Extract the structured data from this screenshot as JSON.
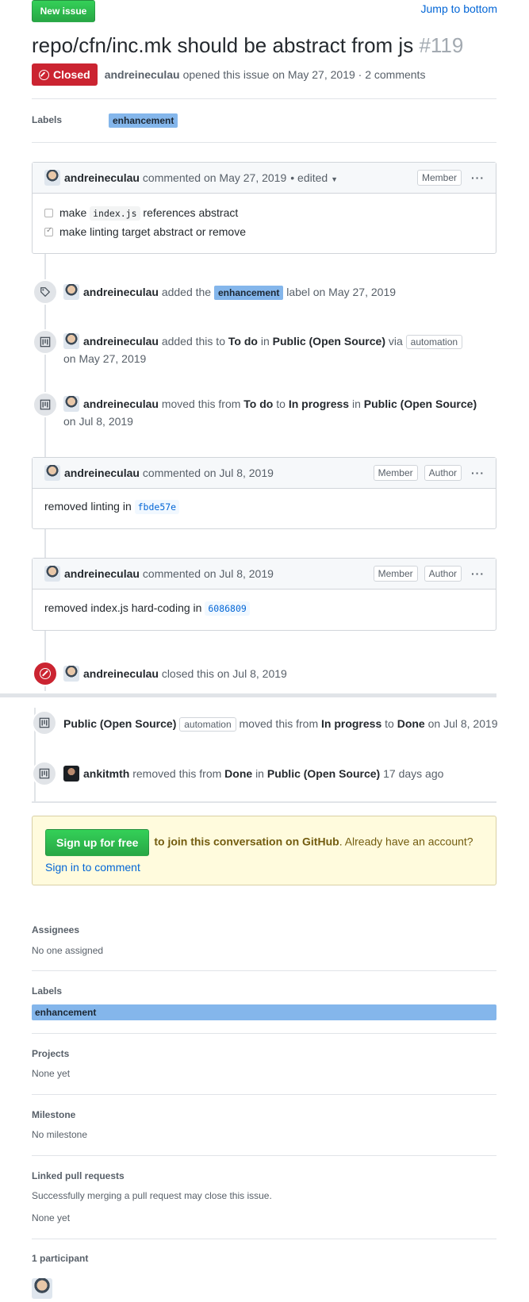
{
  "header": {
    "new_issue_label": "New issue",
    "jump_label": "Jump to bottom",
    "title": "repo/cfn/inc.mk should be abstract from js",
    "number": "#119",
    "state_label": "Closed",
    "author": "andreineculau",
    "meta": "opened this issue on May 27, 2019 · 2 comments"
  },
  "labels_row": {
    "heading": "Labels",
    "label": "enhancement"
  },
  "comment1": {
    "author": "andreineculau",
    "meta": "commented on May 27, 2019",
    "edited": "• edited",
    "role": "Member",
    "tasks": [
      {
        "pre": "make",
        "code": "index.js",
        "post": "references abstract",
        "checked": false
      },
      {
        "text": "make linting target abstract or remove",
        "checked": true
      }
    ]
  },
  "events": {
    "label_added": {
      "user": "andreineculau",
      "t1": "added the",
      "label": "enhancement",
      "t2": "label on May 27, 2019"
    },
    "project_added": {
      "user": "andreineculau",
      "t1": "added this to",
      "col": "To do",
      "t2": "in",
      "project": "Public (Open Source)",
      "t3": "via",
      "tag": "automation",
      "date": "on May 27, 2019"
    },
    "project_moved": {
      "user": "andreineculau",
      "t1": "moved this from",
      "from": "To do",
      "t2": "to",
      "to": "In progress",
      "t3": "in",
      "project": "Public (Open Source)",
      "date": "on Jul 8, 2019"
    },
    "closed": {
      "user": "andreineculau",
      "text": "closed this on Jul 8, 2019"
    },
    "auto_moved": {
      "project": "Public (Open Source)",
      "tag": "automation",
      "t1": "moved this from",
      "from": "In progress",
      "t2": "to",
      "to": "Done",
      "date": "on Jul 8, 2019"
    },
    "removed": {
      "user": "ankitmth",
      "t1": "removed this from",
      "col": "Done",
      "t2": "in",
      "project": "Public (Open Source)",
      "date": "17 days ago"
    }
  },
  "comment2": {
    "author": "andreineculau",
    "meta": "commented on Jul 8, 2019",
    "role": "Member",
    "role2": "Author",
    "body": "removed linting in",
    "sha": "fbde57e"
  },
  "comment3": {
    "author": "andreineculau",
    "meta": "commented on Jul 8, 2019",
    "role": "Member",
    "role2": "Author",
    "body": "removed index.js hard-coding in",
    "sha": "6086809"
  },
  "signup": {
    "button": "Sign up for free",
    "bold": "to join this conversation on GitHub",
    "text": ". Already have an account?",
    "link": "Sign in to comment"
  },
  "sidebar": {
    "assignees_h": "Assignees",
    "assignees_v": "No one assigned",
    "labels_h": "Labels",
    "label": "enhancement",
    "projects_h": "Projects",
    "projects_v": "None yet",
    "milestone_h": "Milestone",
    "milestone_v": "No milestone",
    "linked_h": "Linked pull requests",
    "linked_desc": "Successfully merging a pull request may close this issue.",
    "linked_v": "None yet",
    "participants_h": "1 participant"
  },
  "colors": {
    "green": "#28a745",
    "closed_red": "#cb2431",
    "label_blue": "#84b6eb",
    "link": "#0366d6",
    "signup_bg": "#fffbdd"
  }
}
